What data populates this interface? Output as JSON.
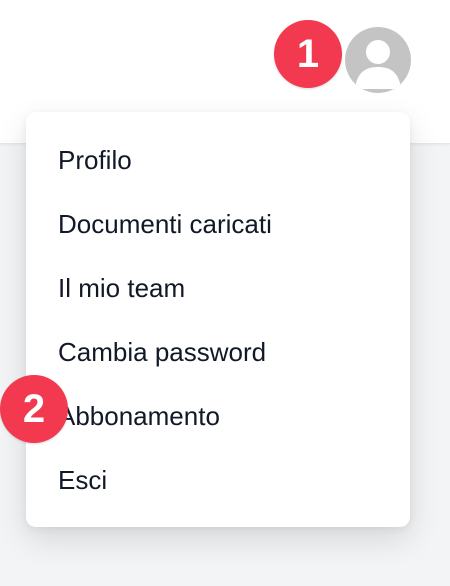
{
  "header": {
    "badge_user": "1"
  },
  "menu": {
    "items": [
      {
        "label": "Profilo"
      },
      {
        "label": "Documenti caricati"
      },
      {
        "label": "Il mio team"
      },
      {
        "label": "Cambia password"
      },
      {
        "label": "Abbonamento"
      },
      {
        "label": "Esci"
      }
    ],
    "badge_subscription": "2"
  },
  "colors": {
    "badge": "#f2394f",
    "avatar": "#c4c4c4",
    "avatar_figure": "#ffffff"
  },
  "icons": {
    "avatar": "user-avatar-icon"
  }
}
